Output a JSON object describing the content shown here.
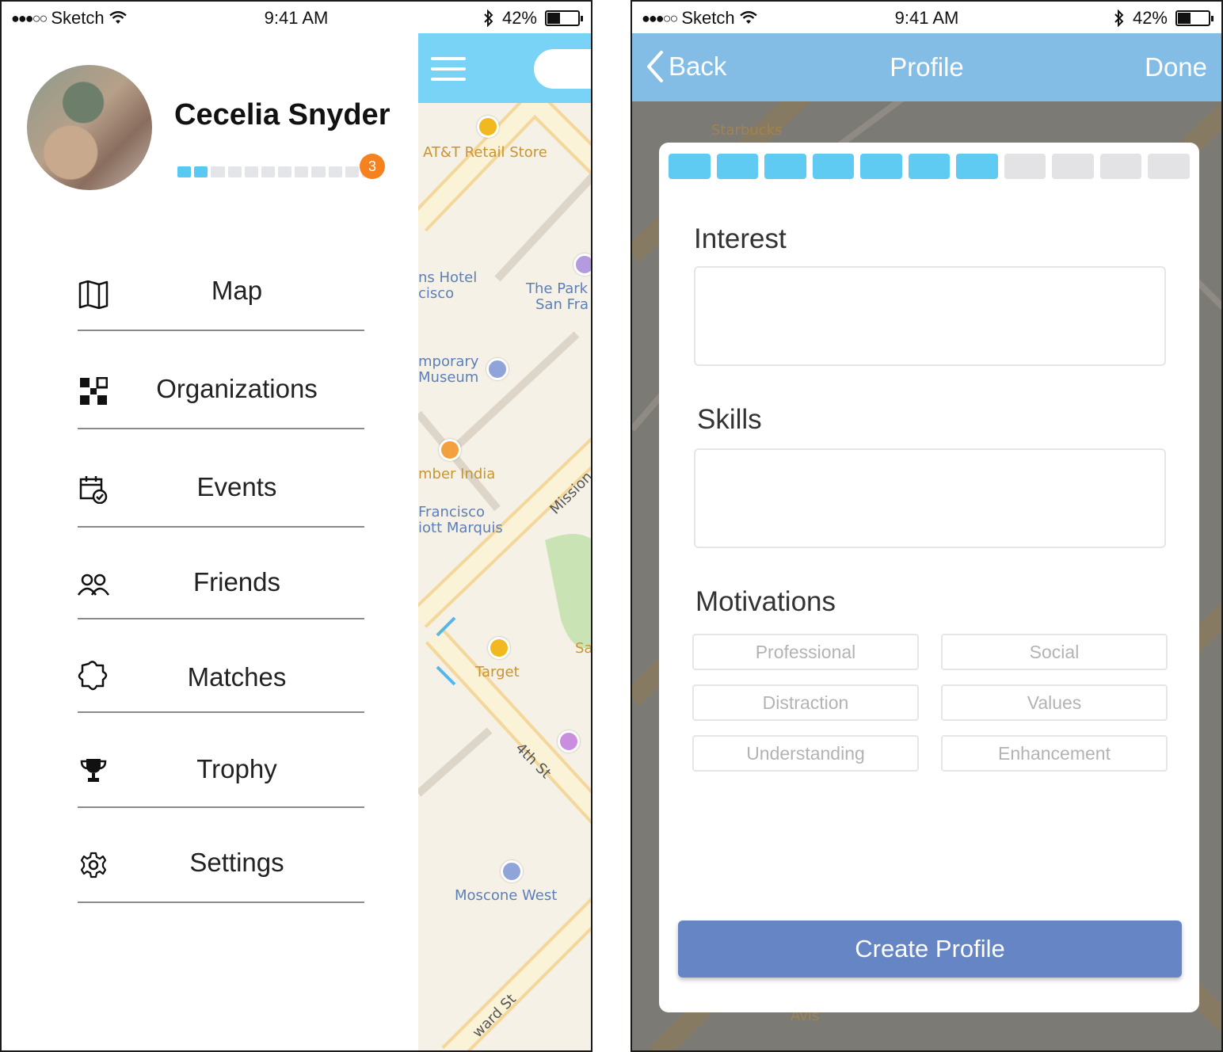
{
  "status_bar": {
    "signal": "●●●○○",
    "carrier": "Sketch",
    "time": "9:41 AM",
    "battery_percent": "42%",
    "battery_level": 0.42
  },
  "drawer": {
    "user_name": "Cecelia Snyder",
    "level_badge": "3",
    "progress_fraction": 0.2,
    "menu": [
      {
        "label": "Map",
        "icon": "map-icon"
      },
      {
        "label": "Organizations",
        "icon": "organizations-icon"
      },
      {
        "label": "Events",
        "icon": "calendar-check-icon"
      },
      {
        "label": "Friends",
        "icon": "friends-icon"
      },
      {
        "label": "Matches",
        "icon": "puzzle-icon"
      },
      {
        "label": "Trophy",
        "icon": "trophy-icon"
      },
      {
        "label": "Settings",
        "icon": "gear-icon"
      }
    ]
  },
  "map_left": {
    "labels": [
      "AT&T Retail Store",
      "ns Hotel",
      "cisco",
      "The Park",
      "San Fra",
      "mporary",
      "Museum",
      "mber India",
      "Francisco",
      "iott Marquis",
      "Mission",
      "Target",
      "Sa",
      "4th St",
      "Moscone West",
      "ward St"
    ]
  },
  "map_right": {
    "labels": [
      "Starbucks",
      "Avis"
    ]
  },
  "profile_screen": {
    "back_label": "Back",
    "title": "Profile",
    "done_label": "Done",
    "steps_total": 11,
    "steps_completed": 7,
    "interest_label": "Interest",
    "skills_label": "Skills",
    "motivations_label": "Motivations",
    "motivations": [
      "Professional",
      "Social",
      "Distraction",
      "Values",
      "Understanding",
      "Enhancement"
    ],
    "create_button": "Create Profile"
  },
  "colors": {
    "nav_blue": "#83bde6",
    "map_bar_blue": "#79d3f7",
    "step_active": "#5fcaf2",
    "button": "#6585c4",
    "badge": "#f5821f"
  }
}
